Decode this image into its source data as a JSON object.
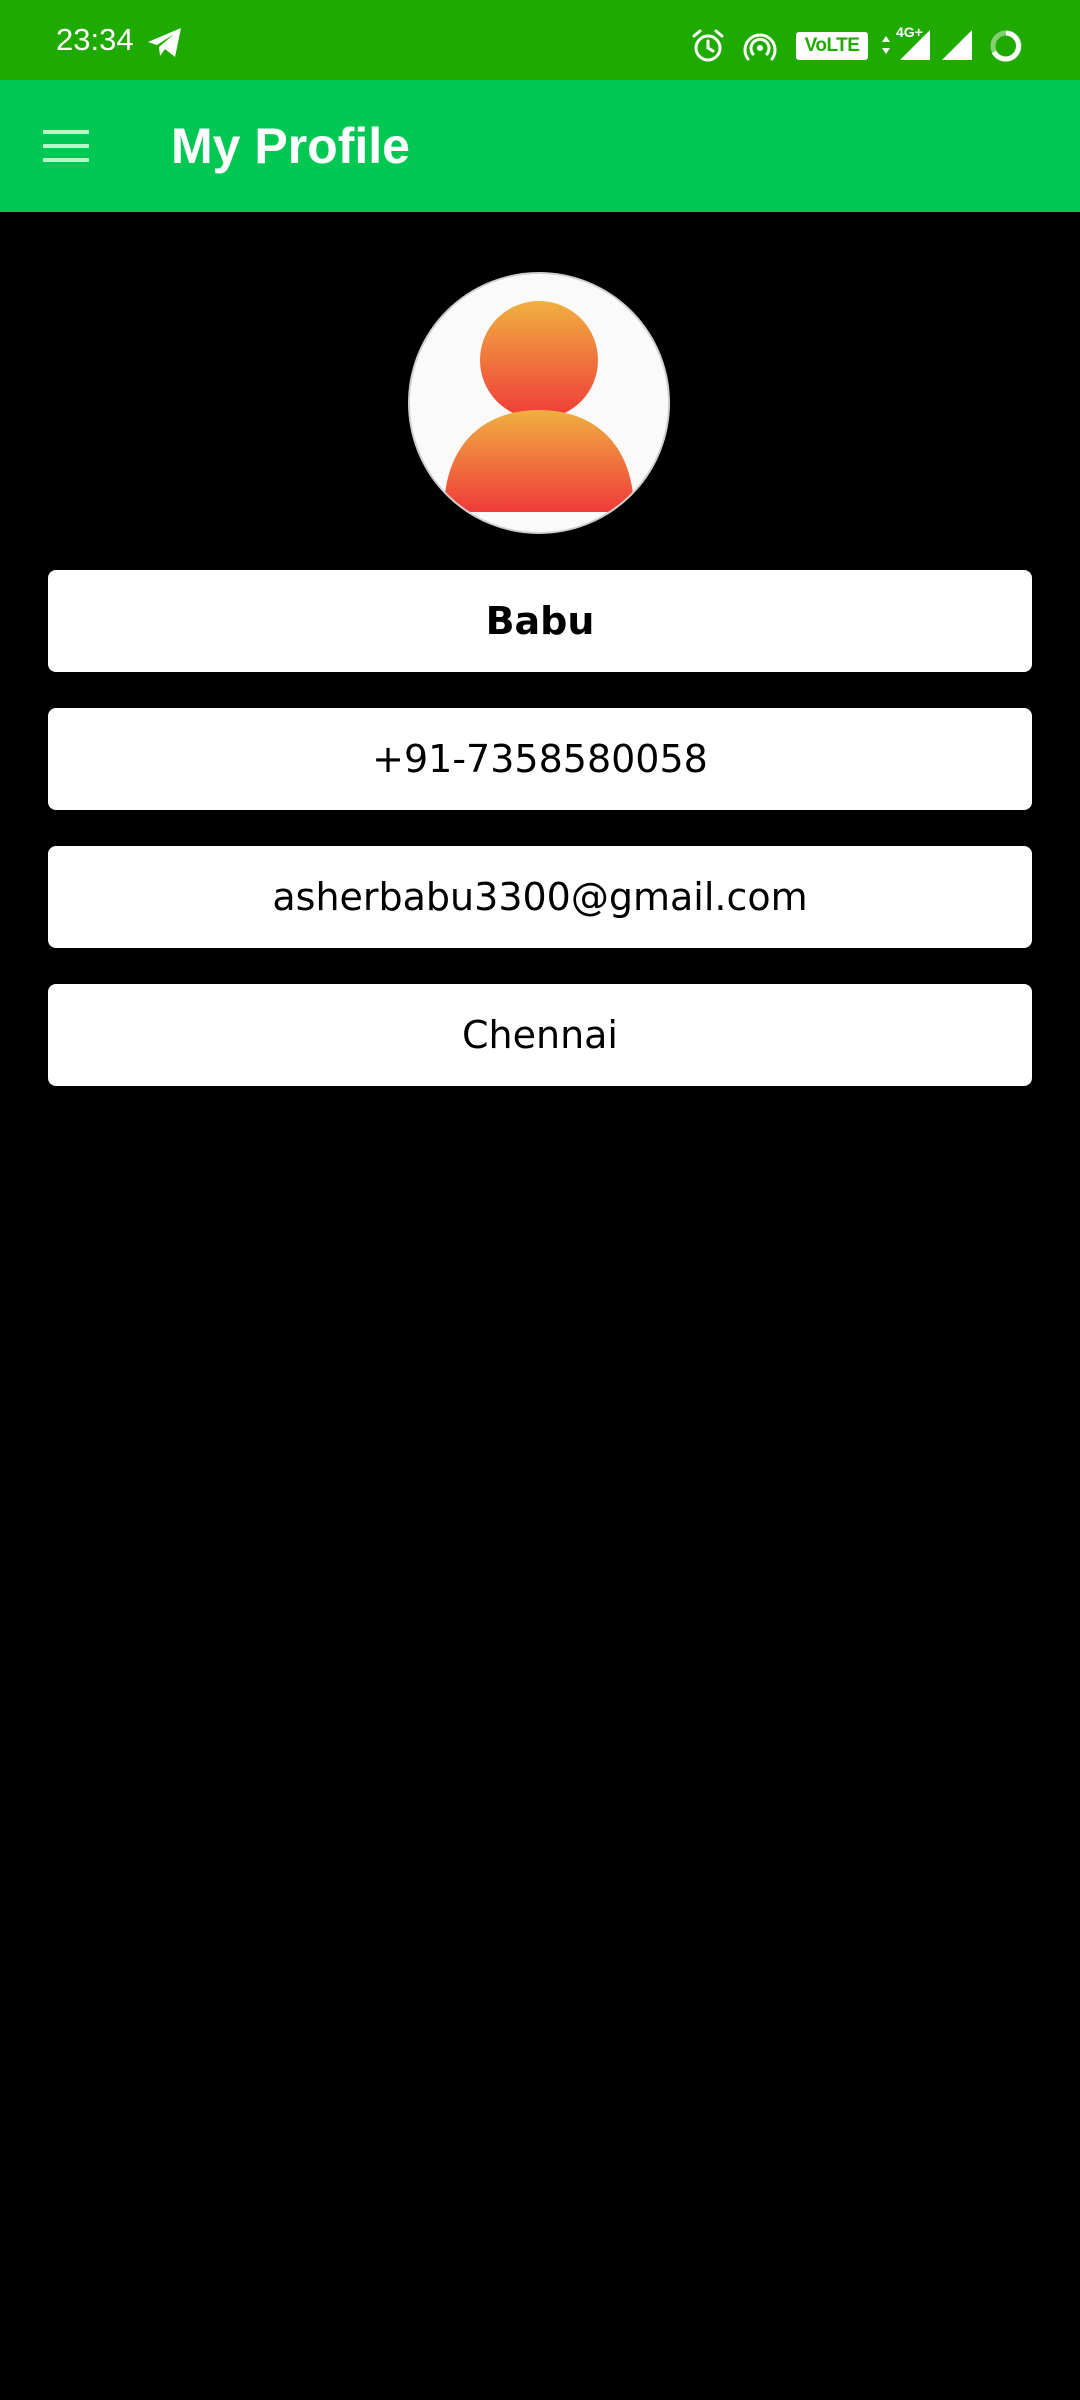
{
  "status_bar": {
    "time": "23:34",
    "volte": "VoLTE",
    "network_type": "4G+",
    "icons": [
      "telegram-icon",
      "alarm-icon",
      "hotspot-icon",
      "data-arrows-icon",
      "signal-icon",
      "signal-icon",
      "battery-icon"
    ]
  },
  "app_bar": {
    "title": "My Profile",
    "menu_icon": "hamburger-menu-icon"
  },
  "profile": {
    "avatar_icon": "user-avatar-icon",
    "name": "Babu",
    "phone": "+91-7358580058",
    "email": "asherbabu3300@gmail.com",
    "city": "Chennai"
  },
  "colors": {
    "status_bar": "#1faa00",
    "app_bar": "#00c853",
    "background": "#000000",
    "field_background": "#ffffff",
    "avatar_gradient_top": "#f0b040",
    "avatar_gradient_bottom": "#f03a3a"
  }
}
